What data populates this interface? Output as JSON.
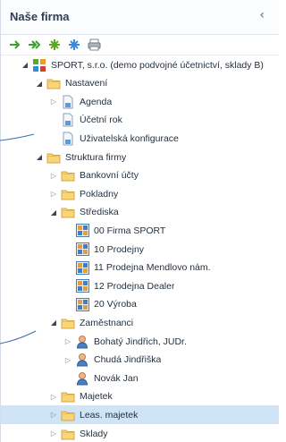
{
  "panel": {
    "title": "Naše firma",
    "collapse_glyph": "‹"
  },
  "toolbar": [
    {
      "icon": "arrow-right-icon"
    },
    {
      "icon": "double-arrow-right-icon"
    },
    {
      "icon": "expand-all-icon"
    },
    {
      "icon": "collapse-all-icon"
    },
    {
      "icon": "print-icon"
    }
  ],
  "tree": [
    {
      "label": "SPORT, s.r.o. (demo podvojné účetnictví, sklady B)",
      "expander": "open",
      "icon": "company",
      "depth": 0
    },
    {
      "label": "Nastavení",
      "expander": "open",
      "icon": "folder",
      "depth": 1
    },
    {
      "label": "Agenda",
      "expander": "closed",
      "icon": "doc",
      "depth": 2
    },
    {
      "label": "Účetní rok",
      "expander": "none",
      "icon": "doc",
      "depth": 2
    },
    {
      "label": "Uživatelská konfigurace",
      "expander": "none",
      "icon": "doc",
      "depth": 2
    },
    {
      "label": "Struktura firmy",
      "expander": "open",
      "icon": "folder",
      "depth": 1
    },
    {
      "label": "Bankovní účty",
      "expander": "closed",
      "icon": "folder",
      "depth": 2
    },
    {
      "label": "Pokladny",
      "expander": "closed",
      "icon": "folder",
      "depth": 2
    },
    {
      "label": "Střediska",
      "expander": "open",
      "icon": "folder",
      "depth": 2
    },
    {
      "label": "00 Firma SPORT",
      "expander": "none",
      "icon": "grid",
      "depth": 3
    },
    {
      "label": "10 Prodejny",
      "expander": "none",
      "icon": "grid",
      "depth": 3
    },
    {
      "label": "11 Prodejna Mendlovo nám.",
      "expander": "none",
      "icon": "grid",
      "depth": 3
    },
    {
      "label": "12 Prodejna Dealer",
      "expander": "none",
      "icon": "grid",
      "depth": 3
    },
    {
      "label": "20 Výroba",
      "expander": "none",
      "icon": "grid",
      "depth": 3
    },
    {
      "label": "Zaměstnanci",
      "expander": "open",
      "icon": "folder",
      "depth": 2
    },
    {
      "label": "Bohatý Jindřich, JUDr.",
      "expander": "closed",
      "icon": "person",
      "depth": 3
    },
    {
      "label": "Chudá Jindřiška",
      "expander": "closed",
      "icon": "person",
      "depth": 3
    },
    {
      "label": "Novák Jan",
      "expander": "none",
      "icon": "person",
      "depth": 3
    },
    {
      "label": "Majetek",
      "expander": "closed",
      "icon": "folder",
      "depth": 2
    },
    {
      "label": "Leas. majetek",
      "expander": "closed",
      "icon": "folder",
      "depth": 2,
      "selected": true
    },
    {
      "label": "Sklady",
      "expander": "closed",
      "icon": "folder",
      "depth": 2
    }
  ]
}
